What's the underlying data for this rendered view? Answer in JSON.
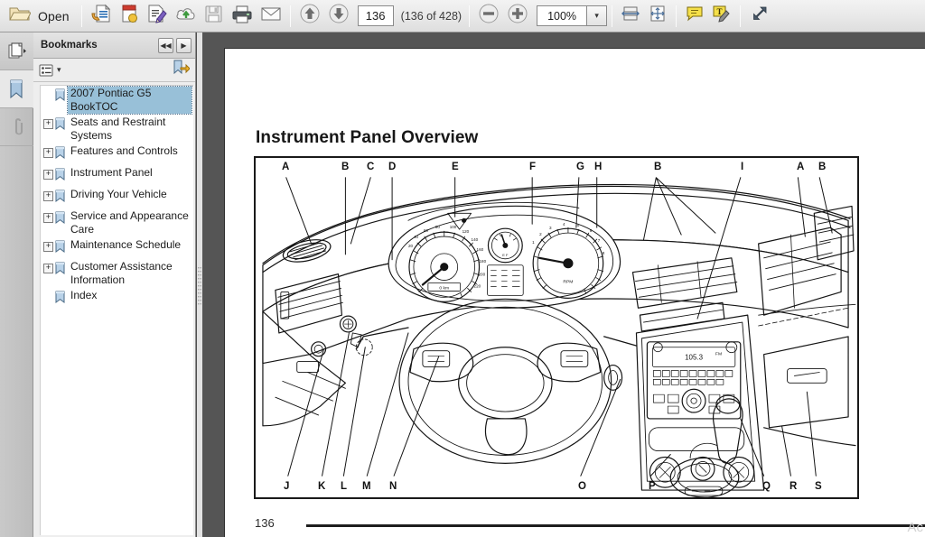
{
  "toolbar": {
    "open_label": "Open",
    "buttons": [
      {
        "name": "open-folder-icon",
        "title": "Open"
      },
      {
        "name": "create-pdf-icon",
        "title": "Create PDF"
      },
      {
        "name": "combine-files-icon",
        "title": "Combine Files"
      },
      {
        "name": "edit-pdf-icon",
        "title": "Edit PDF"
      },
      {
        "name": "upload-cloud-icon",
        "title": "Send to Cloud"
      },
      {
        "name": "save-icon",
        "title": "Save"
      },
      {
        "name": "print-icon",
        "title": "Print"
      },
      {
        "name": "email-icon",
        "title": "Email"
      }
    ],
    "page_up_title": "Previous Page",
    "page_down_title": "Next Page",
    "page_value": "136",
    "page_count_label": "(136 of 428)",
    "zoom_out_title": "Zoom Out",
    "zoom_in_title": "Zoom In",
    "zoom_value": "100%",
    "zoom_dropdown_glyph": "▾",
    "fit_width_title": "Fit Width",
    "fit_page_title": "Fit Page",
    "comment_title": "Add Sticky Note",
    "highlight_title": "Highlight Text",
    "fullscreen_title": "Full Screen"
  },
  "rail": {
    "items": [
      {
        "name": "page-thumbnails-icon",
        "title": "Page Thumbnails",
        "active": false
      },
      {
        "name": "bookmarks-icon",
        "title": "Bookmarks",
        "active": true
      },
      {
        "name": "attachments-icon",
        "title": "Attachments",
        "active": false
      }
    ]
  },
  "bookmarks_panel": {
    "title": "Bookmarks",
    "prev_glyph": "◀◀",
    "next_glyph": "▶",
    "options_title": "Bookmark Options",
    "options_caret": "▾",
    "new_bookmark_title": "New Bookmark",
    "items": [
      {
        "label": "2007 Pontiac G5 BookTOC",
        "expandable": false,
        "selected": true
      },
      {
        "label": "Seats and Restraint Systems",
        "expandable": true,
        "selected": false
      },
      {
        "label": "Features and Controls",
        "expandable": true,
        "selected": false
      },
      {
        "label": "Instrument Panel",
        "expandable": true,
        "selected": false
      },
      {
        "label": "Driving Your Vehicle",
        "expandable": true,
        "selected": false
      },
      {
        "label": "Service and Appearance Care",
        "expandable": true,
        "selected": false
      },
      {
        "label": "Maintenance Schedule",
        "expandable": true,
        "selected": false
      },
      {
        "label": "Customer Assistance Information",
        "expandable": true,
        "selected": false
      },
      {
        "label": "Index",
        "expandable": false,
        "selected": false
      }
    ],
    "expand_glyph": "+"
  },
  "document": {
    "heading": "Instrument Panel Overview",
    "page_number": "136",
    "watermark": "Ac",
    "figure_alt": "Line drawing of a 2007 Pontiac G5 instrument panel with lettered callouts",
    "callouts_top": [
      "A",
      "B",
      "C",
      "D",
      "E",
      "F",
      "G",
      "H",
      "B",
      "I",
      "A",
      "B"
    ],
    "callouts_bottom": [
      "J",
      "K",
      "L",
      "M",
      "N",
      "O",
      "P",
      "Q",
      "R",
      "S"
    ]
  },
  "colors": {
    "selection": "#98c0d8",
    "toolbar_bg": "#e9e9e9",
    "viewport_bg": "#555555",
    "page_bg": "#ffffff",
    "ink": "#1a1a1a"
  }
}
